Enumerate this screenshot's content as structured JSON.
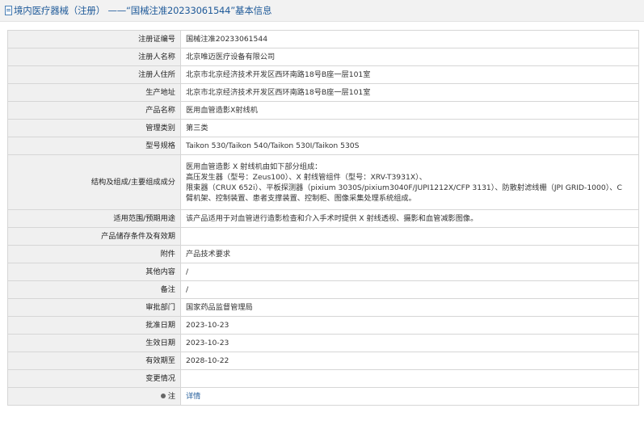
{
  "header": {
    "title": "境内医疗器械（注册） ——“国械注准20233061544”基本信息"
  },
  "rows": [
    {
      "label": "注册证编号",
      "value": "国械注准20233061544",
      "h": 22
    },
    {
      "label": "注册人名称",
      "value": "北京唯迈医疗设备有限公司",
      "h": 22
    },
    {
      "label": "注册人住所",
      "value": "北京市北京经济技术开发区西环南路18号B座一层101室",
      "h": 22
    },
    {
      "label": "生产地址",
      "value": "北京市北京经济技术开发区西环南路18号B座一层101室",
      "h": 22
    },
    {
      "label": "产品名称",
      "value": "医用血管造影X射线机",
      "h": 22
    },
    {
      "label": "管理类别",
      "value": "第三类",
      "h": 22
    },
    {
      "label": "型号规格",
      "value": "Taikon 530/Taikon 540/Taikon 530I/Taikon 530S",
      "h": 22
    },
    {
      "label": "结构及组成/主要组成成分",
      "value_lines": [
        "医用血管造影 X 射线机由如下部分组成：",
        "高压发生器（型号：Zeus100）、X 射线管组件（型号：XRV-T3931X）、",
        "限束器（CRUX 652i）、平板探测器（pixium 3030S/pixium3040F/JUPI1212X/CFP 3131）、防散射滤线栅（JPI GRID-1000）、C",
        "臂机架、控制装置、患者支撑装置、控制柜、图像采集处理系统组成。"
      ],
      "h": 68
    },
    {
      "label": "适用范围/预期用途",
      "value": "该产品适用于对血管进行造影检查和介入手术时提供 X 射线透视、摄影和血管减影图像。",
      "h": 22
    },
    {
      "label": "产品储存条件及有效期",
      "value": "",
      "h": 22
    },
    {
      "label": "附件",
      "value": "产品技术要求",
      "h": 22
    },
    {
      "label": "其他内容",
      "value": "/",
      "h": 22
    },
    {
      "label": "备注",
      "value": "/",
      "h": 22
    },
    {
      "label": "审批部门",
      "value": "国家药品监督管理局",
      "h": 22
    },
    {
      "label": "批准日期",
      "value": "2023-10-23",
      "h": 22
    },
    {
      "label": "生效日期",
      "value": "2023-10-23",
      "h": 22
    },
    {
      "label": "有效期至",
      "value": "2028-10-22",
      "h": 22
    },
    {
      "label": "变更情况",
      "value": "",
      "h": 22
    },
    {
      "label": "注",
      "value": "详情",
      "h": 22,
      "icon": "pin-icon",
      "link": true
    }
  ]
}
